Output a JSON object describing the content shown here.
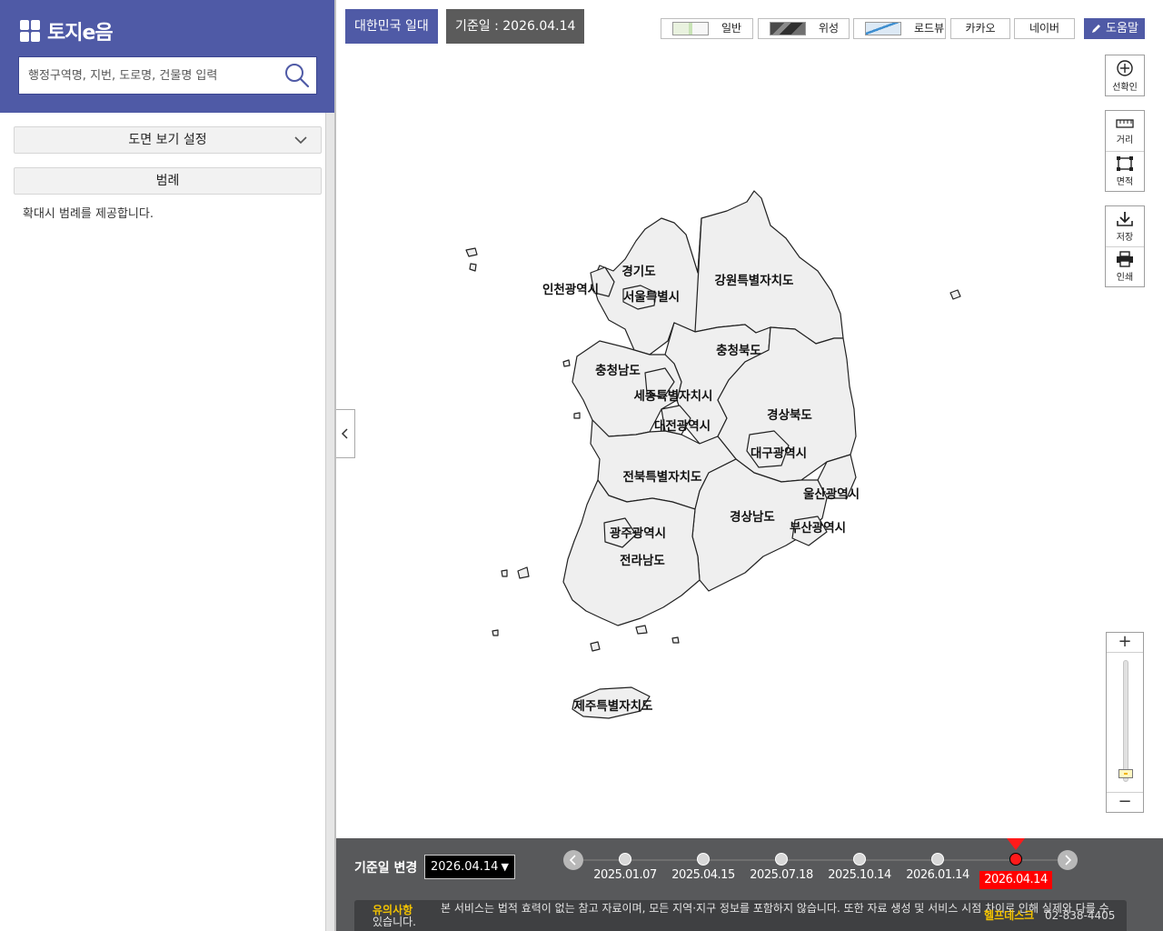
{
  "app": {
    "logo_text": "토지e음",
    "logo_mark": "소통행정"
  },
  "search": {
    "placeholder": "행정구역명, 지번, 도로명, 건물명 입력",
    "value": ""
  },
  "sidebar": {
    "view_settings_label": "도면 보기 설정",
    "legend_label": "범례",
    "legend_note": "확대시 범례를 제공합니다."
  },
  "map": {
    "area_label": "대한민국 일대",
    "date_label": "기준일 : 2026.04.14",
    "map_types": {
      "normal": "일반",
      "satellite": "위성",
      "roadview": "로드뷰",
      "kakao": "카카오",
      "naver": "네이버"
    },
    "help_label": "도움말",
    "tools": {
      "select": "선확인",
      "distance": "거리",
      "area": "면적",
      "save": "저장",
      "print": "인쇄"
    },
    "zoom": {
      "in": "+",
      "out": "−",
      "level_fraction": 0.03
    },
    "regions": [
      "경기도",
      "인천광역시",
      "서울특별시",
      "강원특별자치도",
      "충청북도",
      "충청남도",
      "세종특별자치시",
      "경상북도",
      "대전광역시",
      "대구광역시",
      "전북특별자치도",
      "울산광역시",
      "경상남도",
      "광주광역시",
      "부산광역시",
      "전라남도",
      "제주특별자치도"
    ]
  },
  "timeline": {
    "label": "기준일 변경",
    "selected": "2026.04.14",
    "dates": [
      "2025.01.07",
      "2025.04.15",
      "2025.07.18",
      "2025.10.14",
      "2026.01.14",
      "2026.04.14"
    ],
    "active_index": 5
  },
  "notice": {
    "title": "유의사항",
    "body": "본 서비스는 법적 효력이 없는 참고 자료이며, 모든 지역·지구 정보를 포함하지 않습니다. 또한 자료 생성 및 서비스 시점 차이로 인해 실제와 다를 수 있습니다.",
    "helpdesk_title": "헬프데스크",
    "helpdesk_phone": "02-838-4405"
  },
  "colors": {
    "brand": "#4f5aa6",
    "timeline_bg": "#58595b",
    "active": "#ff0000",
    "notice_title": "#f3c300",
    "map_fill": "#efefef"
  }
}
